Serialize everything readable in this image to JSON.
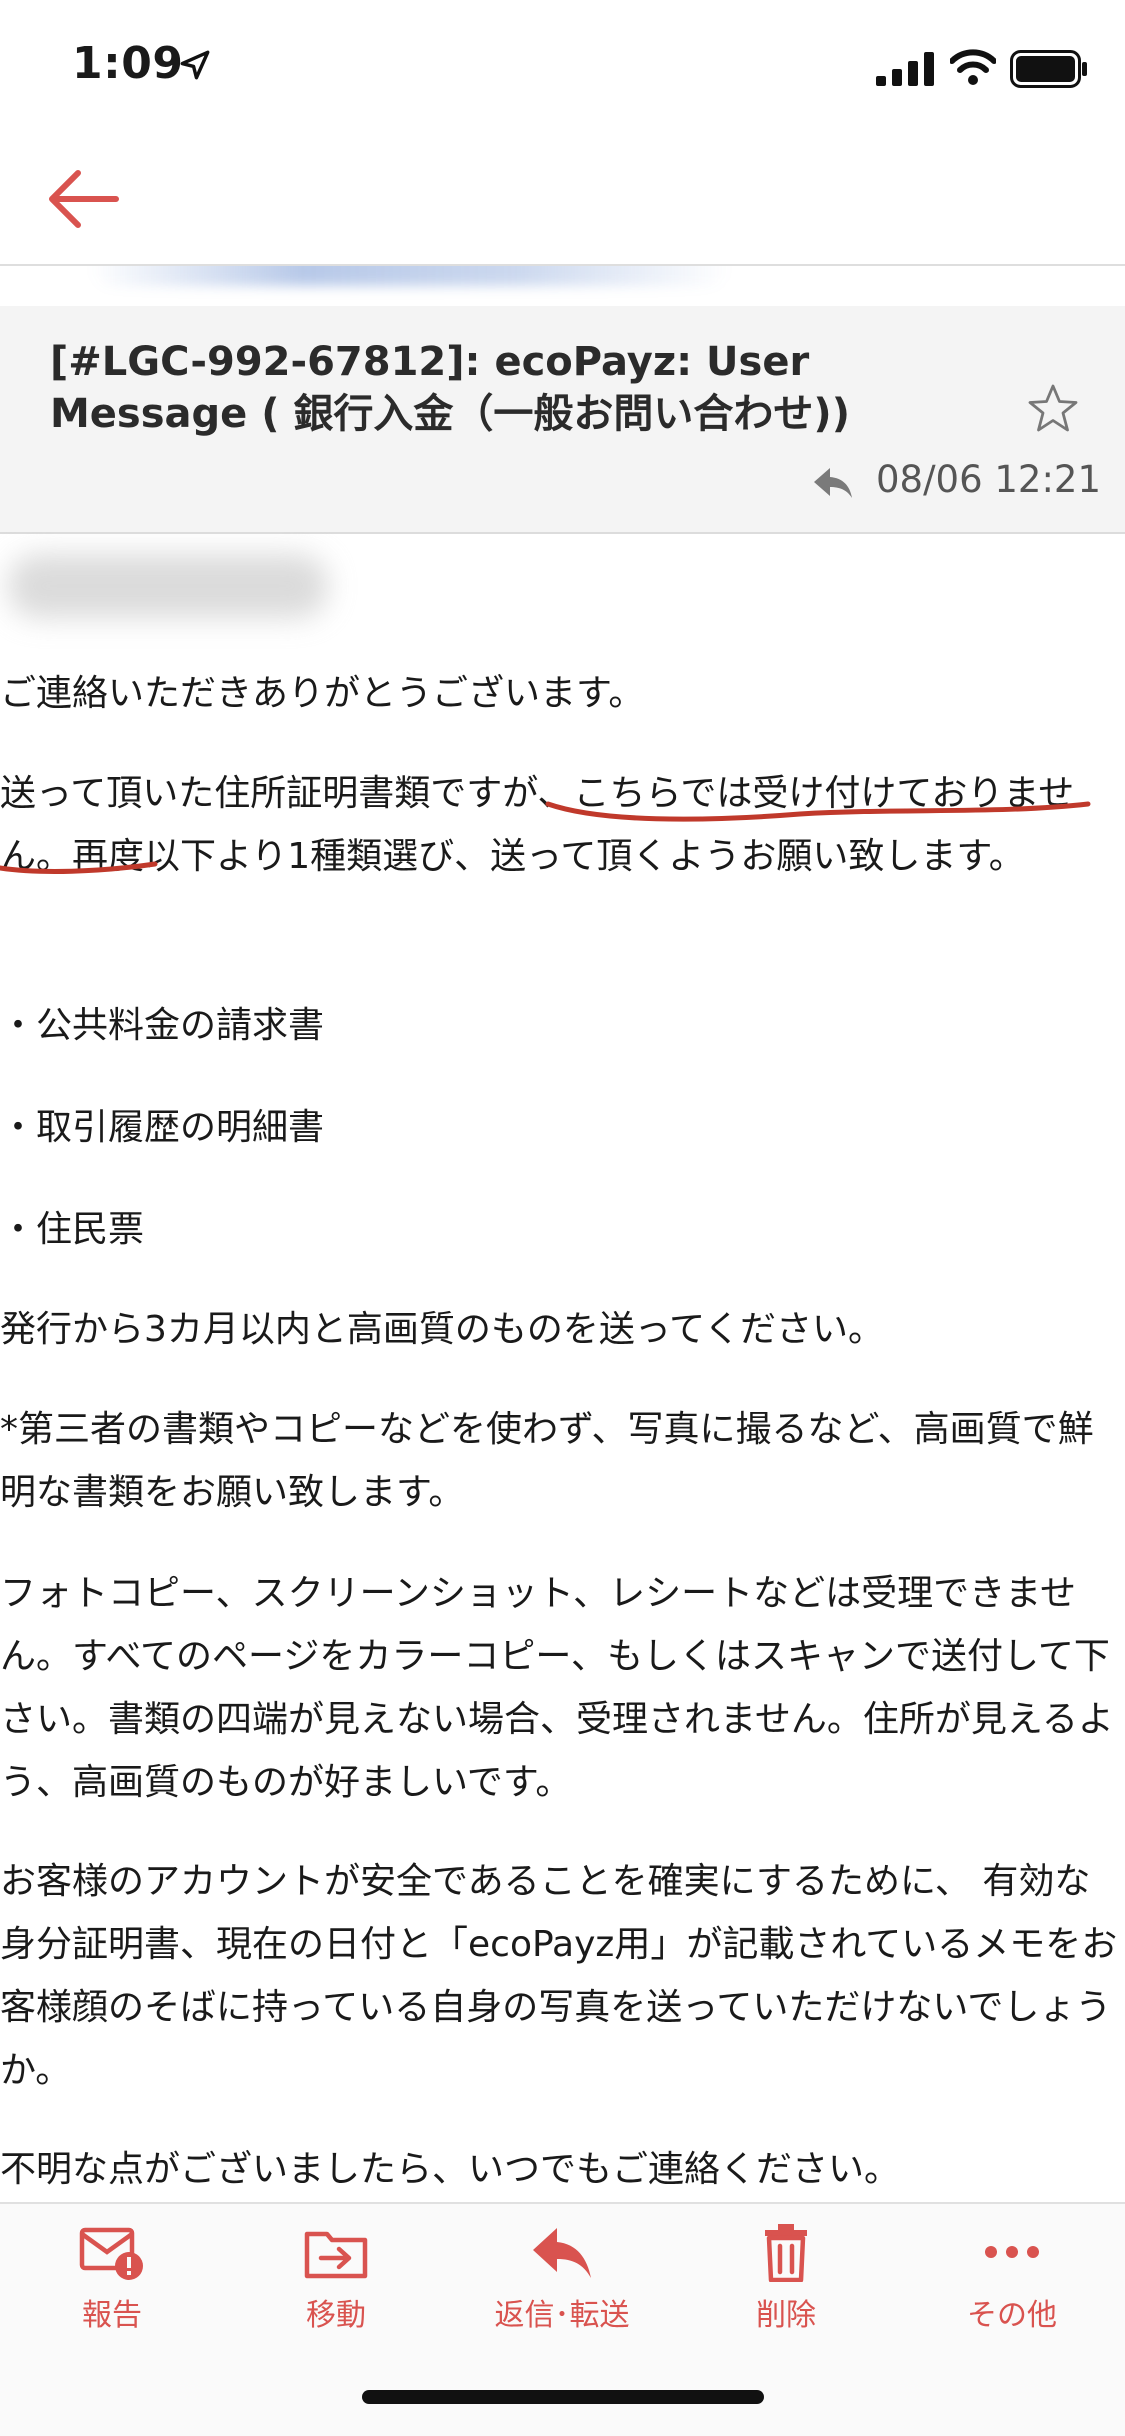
{
  "status": {
    "time": "1:09"
  },
  "email": {
    "subject": "[#LGC-992-67812]: ecoPayz: User Message ( 銀行入金（一般お問い合わせ))",
    "date": "08/06 12:21",
    "body": [
      "ご連絡いただきありがとうございます。",
      "送って頂いた住所証明書類ですが、こちらでは受け付けておりません。再度以下より1種類選び、送って頂くようお願い致します。",
      "・公共料金の請求書",
      "・取引履歴の明細書",
      "・住民票",
      "発行から3カ月以内と高画質のものを送ってください。",
      "*第三者の書類やコピーなどを使わず、写真に撮るなど、高画質で鮮明な書類をお願い致します。",
      "フォトコピー、スクリーンショット、レシートなどは受理できません。すべてのページをカラーコピー、もしくはスキャンで送付して下さい。書類の四端が見えない場合、受理されません。住所が見えるよう、高画質のものが好ましいです。",
      "お客様のアカウントが安全であることを確実にするために、 有効な身分証明書、現在の日付と「ecoPayz用」が記載されているメモをお客様顔のそばに持っている自身の写真を送っていただけないでしょうか。",
      "不明な点がございましたら、いつでもご連絡ください。"
    ]
  },
  "toolbar": {
    "report": "報告",
    "move": "移動",
    "reply_forward": "返信･転送",
    "delete": "削除",
    "more": "その他"
  },
  "colors": {
    "accent": "#d9534f",
    "annotation": "#c0392b",
    "header_bg": "#f4f4f4"
  }
}
